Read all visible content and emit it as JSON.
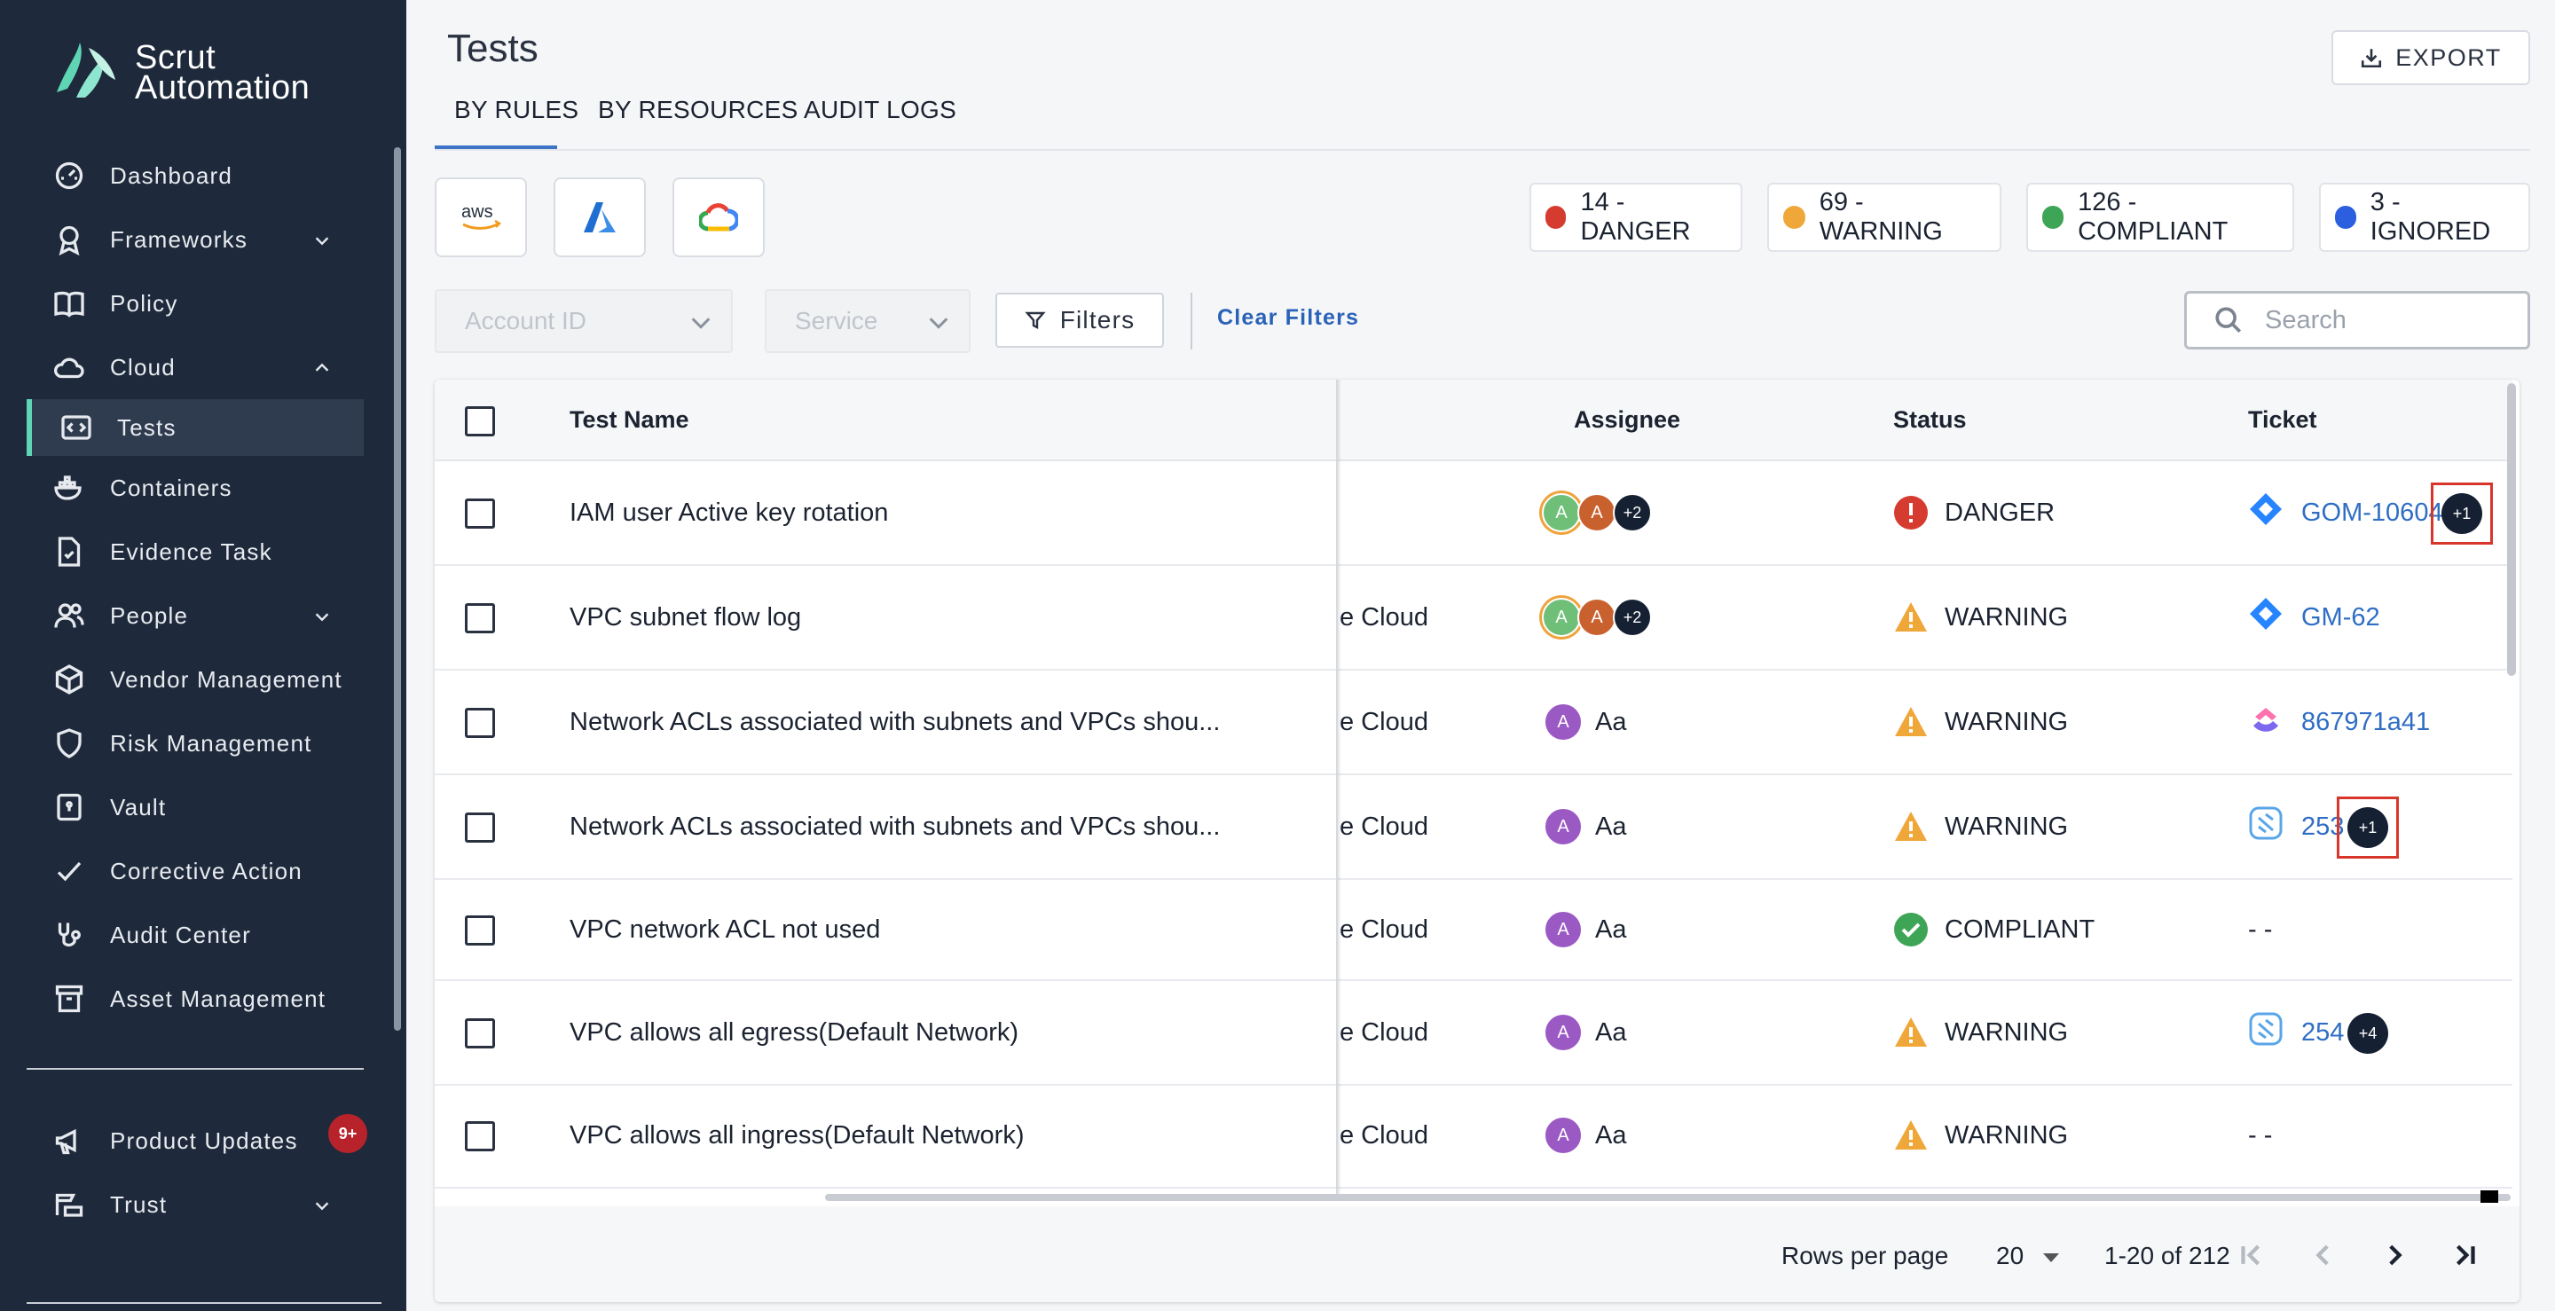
{
  "brand": {
    "line1": "Scrut",
    "line2": "Automation"
  },
  "sidebar": {
    "items": [
      {
        "label": "Dashboard",
        "icon": "dashboard-icon"
      },
      {
        "label": "Frameworks",
        "icon": "award-icon",
        "expandable": true
      },
      {
        "label": "Policy",
        "icon": "book-icon"
      },
      {
        "label": "Cloud",
        "icon": "cloud-icon",
        "expanded": true
      },
      {
        "label": "Tests",
        "icon": "code-window-icon",
        "active": true
      },
      {
        "label": "Containers",
        "icon": "docker-icon"
      },
      {
        "label": "Evidence Task",
        "icon": "file-check-icon"
      },
      {
        "label": "People",
        "icon": "users-icon",
        "expandable": true
      },
      {
        "label": "Vendor Management",
        "icon": "box-icon"
      },
      {
        "label": "Risk Management",
        "icon": "shield-icon"
      },
      {
        "label": "Vault",
        "icon": "vault-icon"
      },
      {
        "label": "Corrective Action",
        "icon": "check-icon"
      },
      {
        "label": "Audit Center",
        "icon": "stethoscope-icon"
      },
      {
        "label": "Asset Management",
        "icon": "archive-icon"
      }
    ],
    "bottom": [
      {
        "label": "Product Updates",
        "icon": "megaphone-icon",
        "badge": "9+"
      },
      {
        "label": "Trust",
        "icon": "trust-icon",
        "expandable": true
      }
    ]
  },
  "header": {
    "title": "Tests",
    "export_label": "EXPORT",
    "tabs": [
      "BY RULES",
      "BY RESOURCES",
      "AUDIT LOGS"
    ]
  },
  "clouds": [
    "aws",
    "Azure",
    "Google Cloud"
  ],
  "status_summary": [
    {
      "label": "14 - DANGER",
      "color": "#d63b30"
    },
    {
      "label": "69 - WARNING",
      "color": "#f0a73a"
    },
    {
      "label": "126 - COMPLIANT",
      "color": "#3fa556"
    },
    {
      "label": "3 - IGNORED",
      "color": "#2c5fe0"
    }
  ],
  "filters": {
    "account_placeholder": "Account ID",
    "service_placeholder": "Service",
    "filters_label": "Filters",
    "clear_label": "Clear Filters",
    "search_placeholder": "Search"
  },
  "table": {
    "headers": {
      "name": "Test Name",
      "assignee": "Assignee",
      "status": "Status",
      "ticket": "Ticket"
    },
    "rows": [
      {
        "name": "IAM user Active key rotation",
        "provider": "",
        "assignee_type": "group",
        "assignee_more": "+2",
        "status": "DANGER",
        "ticket": "GOM-10604",
        "ticket_type": "jira",
        "ticket_more": "+1"
      },
      {
        "name": "VPC subnet flow log",
        "provider": "e Cloud",
        "assignee_type": "group",
        "assignee_more": "+2",
        "status": "WARNING",
        "ticket": "GM-62",
        "ticket_type": "jira",
        "ticket_more": ""
      },
      {
        "name": "Network ACLs associated with subnets and VPCs shou...",
        "provider": "e Cloud",
        "assignee_type": "single",
        "assignee_name": "Aa",
        "status": "WARNING",
        "ticket": "867971a41",
        "ticket_type": "clickup",
        "ticket_more": ""
      },
      {
        "name": "Network ACLs associated with subnets and VPCs shou...",
        "provider": "e Cloud",
        "assignee_type": "single",
        "assignee_name": "Aa",
        "status": "WARNING",
        "ticket": "253",
        "ticket_type": "shortcut",
        "ticket_more": "+1"
      },
      {
        "name": "VPC network ACL not used",
        "provider": "e Cloud",
        "assignee_type": "single",
        "assignee_name": "Aa",
        "status": "COMPLIANT",
        "ticket": "- -",
        "ticket_type": "none",
        "ticket_more": ""
      },
      {
        "name": "VPC allows all egress(Default Network)",
        "provider": "e Cloud",
        "assignee_type": "single",
        "assignee_name": "Aa",
        "status": "WARNING",
        "ticket": "254",
        "ticket_type": "shortcut",
        "ticket_more": "+4"
      },
      {
        "name": "VPC allows all ingress(Default Network)",
        "provider": "e Cloud",
        "assignee_type": "single",
        "assignee_name": "Aa",
        "status": "WARNING",
        "ticket": "- -",
        "ticket_type": "none",
        "ticket_more": ""
      }
    ]
  },
  "pagination": {
    "rows_label": "Rows per page",
    "rows_value": "20",
    "range": "1-20 of 212"
  }
}
